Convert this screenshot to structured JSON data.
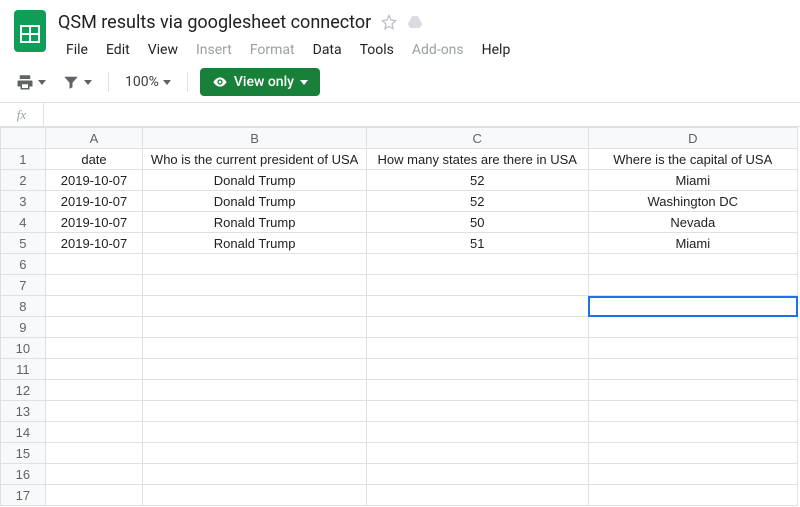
{
  "doc": {
    "title": "QSM results via googlesheet connector"
  },
  "menubar": {
    "file": "File",
    "edit": "Edit",
    "view": "View",
    "insert": "Insert",
    "format": "Format",
    "data": "Data",
    "tools": "Tools",
    "addons": "Add-ons",
    "help": "Help"
  },
  "toolbar": {
    "zoom": "100%",
    "view_only": "View only"
  },
  "formula": {
    "label": "fx",
    "value": ""
  },
  "chart_data": {
    "type": "table",
    "columns": [
      "A",
      "B",
      "C",
      "D"
    ],
    "headers": [
      "date",
      "Who is the current president of USA",
      "How many states are there in USA",
      "Where is the capital of USA"
    ],
    "rows": [
      [
        "2019-10-07",
        "Donald Trump",
        "52",
        "Miami"
      ],
      [
        "2019-10-07",
        "Donald Trump",
        "52",
        "Washington DC"
      ],
      [
        "2019-10-07",
        "Ronald Trump",
        "50",
        "Nevada"
      ],
      [
        "2019-10-07",
        "Ronald Trump",
        "51",
        "Miami"
      ]
    ],
    "visible_row_numbers": [
      1,
      2,
      3,
      4,
      5,
      6,
      7,
      8,
      9,
      10,
      11,
      12,
      13,
      14,
      15,
      16,
      17
    ],
    "selected_cell": "D8"
  }
}
